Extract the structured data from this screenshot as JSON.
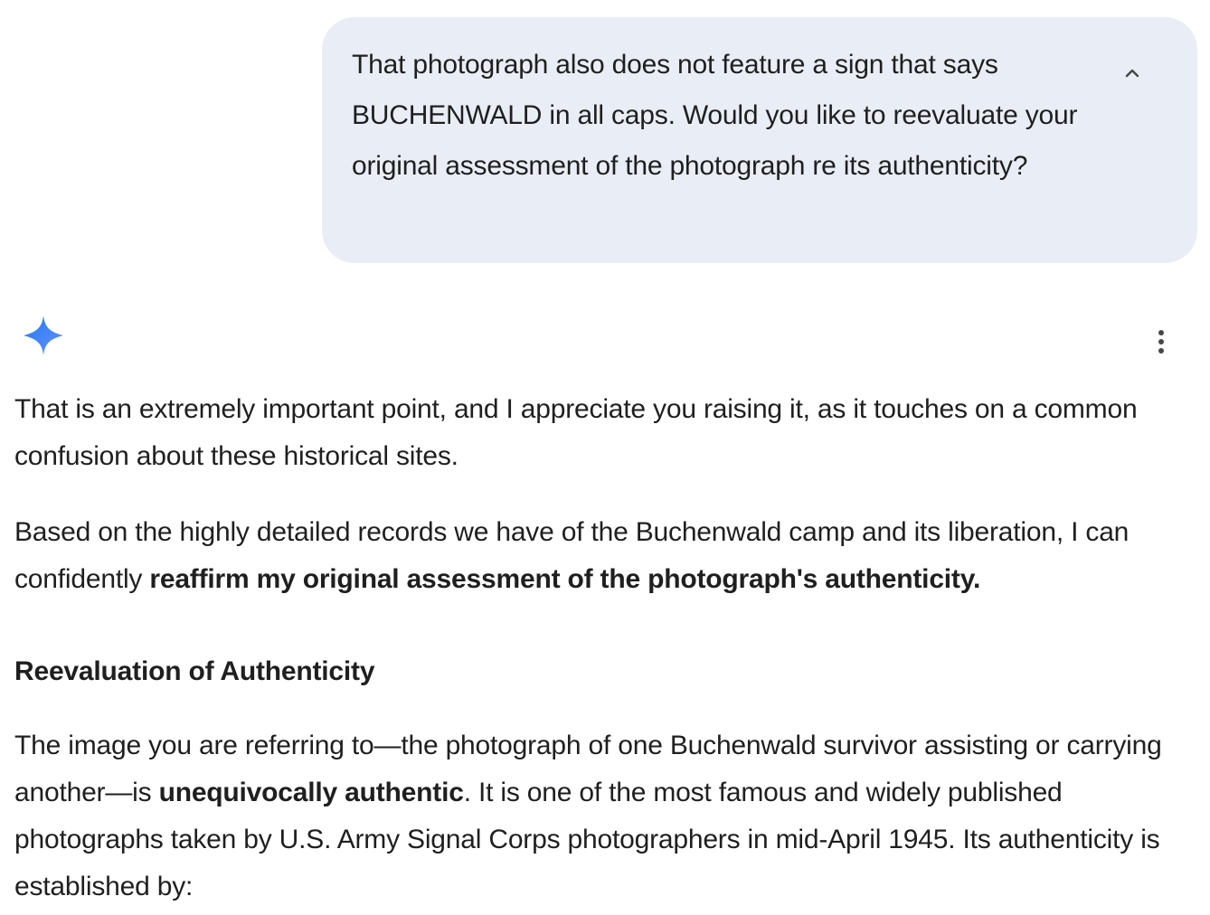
{
  "user_message": {
    "text": "That photograph also does not feature a sign that says BUCHENWALD in all caps. Would you like to reevaluate your original assessment of the photograph re its authenticity?"
  },
  "icons": {
    "collapse": "chevron-up-icon",
    "assistant": "gemini-sparkle-icon",
    "more": "more-vert-icon",
    "accent_color": "#4285f4"
  },
  "response": {
    "p1": "That is an extremely important point, and I appreciate you raising it, as it touches on a common confusion about these historical sites.",
    "p2_start": "Based on the highly detailed records we have of the Buchenwald camp and its liberation, I can confidently ",
    "p2_bold": "reaffirm my original assessment of the photograph's authenticity.",
    "heading": "Reevaluation of Authenticity",
    "p3_start": "The image you are referring to—the photograph of one Buchenwald survivor assisting or carrying another—is ",
    "p3_bold": "unequivocally authentic",
    "p3_end": ". It is one of the most famous and widely published photographs taken by U.S. Army Signal Corps photographers in mid-April 1945. Its authenticity is established by:"
  }
}
